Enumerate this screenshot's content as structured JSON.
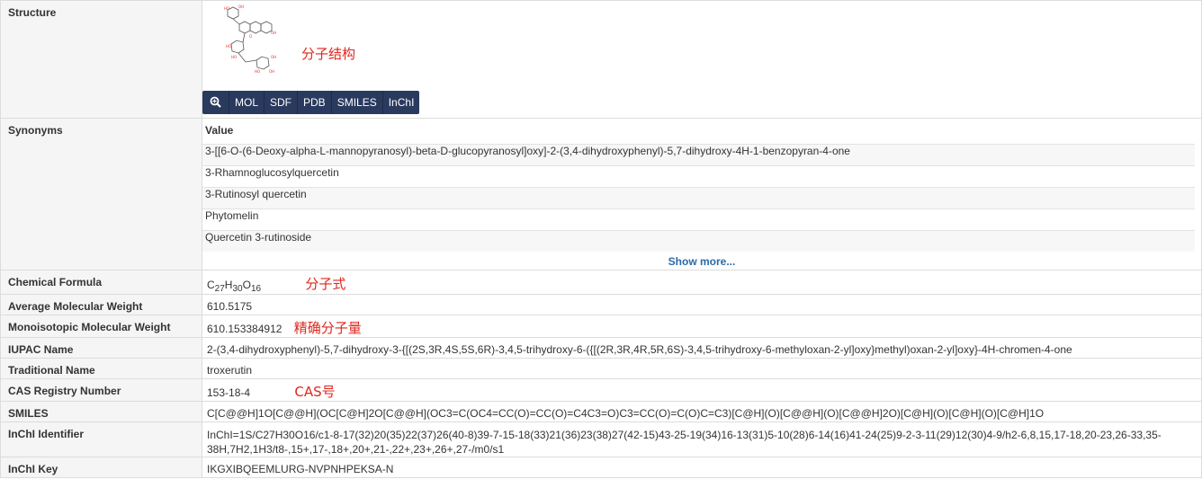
{
  "labels": {
    "structure": "Structure",
    "synonyms": "Synonyms",
    "chemical_formula": "Chemical Formula",
    "average_mw": "Average Molecular Weight",
    "mono_mw": "Monoisotopic Molecular Weight",
    "iupac": "IUPAC Name",
    "traditional": "Traditional Name",
    "cas": "CAS Registry Number",
    "smiles": "SMILES",
    "inchi": "InChI Identifier",
    "inchikey": "InChI Key"
  },
  "structure": {
    "annotation": "分子结构",
    "buttons": [
      "MOL",
      "SDF",
      "PDB",
      "SMILES",
      "InChI"
    ],
    "zoom_icon": "magnifier-plus-icon"
  },
  "synonyms": {
    "header": "Value",
    "items": [
      "3-[[6-O-(6-Deoxy-alpha-L-mannopyranosyl)-beta-D-glucopyranosyl]oxy]-2-(3,4-dihydroxyphenyl)-5,7-dihydroxy-4H-1-benzopyran-4-one",
      "3-Rhamnoglucosylquercetin",
      "3-Rutinosyl quercetin",
      "Phytomelin",
      "Quercetin 3-rutinoside"
    ],
    "show_more": "Show more..."
  },
  "formula": {
    "parts": [
      "C",
      "27",
      "H",
      "30",
      "O",
      "16"
    ],
    "annotation": "分子式"
  },
  "average_mw": "610.5175",
  "mono_mw": {
    "value": "610.153384912",
    "annotation": "精确分子量"
  },
  "iupac": "2-(3,4-dihydroxyphenyl)-5,7-dihydroxy-3-{[(2S,3R,4S,5S,6R)-3,4,5-trihydroxy-6-({[(2R,3R,4R,5R,6S)-3,4,5-trihydroxy-6-methyloxan-2-yl]oxy}methyl)oxan-2-yl]oxy}-4H-chromen-4-one",
  "traditional": "troxerutin",
  "cas": {
    "value": "153-18-4",
    "annotation": "CAS号"
  },
  "smiles": "C[C@@H]1O[C@@H](OC[C@H]2O[C@@H](OC3=C(OC4=CC(O)=CC(O)=C4C3=O)C3=CC(O)=C(O)C=C3)[C@H](O)[C@@H](O)[C@@H]2O)[C@H](O)[C@H](O)[C@H]1O",
  "inchi": {
    "line1": "InChI=1S/C27H30O16/c1-8-17(32)20(35)22(37)26(40-8)39-7-15-18(33)21(36)23(38)27(42-15)43-25-19(34)16-13(31)5-10(28)6-14(16)41-24(25)9-2-3-11(29)12(30)4-9/h2-6,8,15,17-18,20-23,26-33,35-",
    "line2": "38H,7H2,1H3/t8-,15+,17-,18+,20+,21-,22+,23+,26+,27-/m0/s1"
  },
  "inchikey": "IKGXIBQEEMLURG-NVPNHPEKSA-N"
}
